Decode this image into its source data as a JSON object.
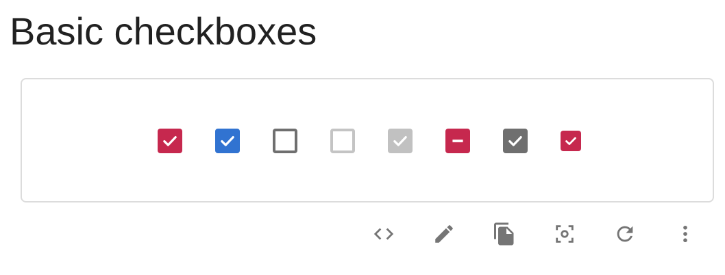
{
  "page": {
    "title": "Basic checkboxes"
  },
  "colors": {
    "primary": "#c6284e",
    "secondary": "#3173d1",
    "unchecked_border": "#6f6f6f",
    "disabled": "#c4c4c4",
    "default_checked": "#6f6f6f",
    "icon": "#757575"
  },
  "checkboxes": [
    {
      "state": "checked",
      "color": "primary",
      "disabled": false,
      "size": "medium"
    },
    {
      "state": "checked",
      "color": "secondary",
      "disabled": false,
      "size": "medium"
    },
    {
      "state": "unchecked",
      "color": "default",
      "disabled": false,
      "size": "medium"
    },
    {
      "state": "unchecked",
      "color": "default",
      "disabled": true,
      "size": "medium"
    },
    {
      "state": "checked",
      "color": "default",
      "disabled": true,
      "size": "medium"
    },
    {
      "state": "indeterminate",
      "color": "primary",
      "disabled": false,
      "size": "medium"
    },
    {
      "state": "checked",
      "color": "default",
      "disabled": false,
      "size": "medium"
    },
    {
      "state": "checked",
      "color": "primary",
      "disabled": false,
      "size": "small"
    }
  ],
  "toolbar": {
    "icons": [
      "code-icon",
      "edit-icon",
      "copy-icon",
      "screenshot-icon",
      "reset-icon",
      "more-vert-icon"
    ]
  }
}
